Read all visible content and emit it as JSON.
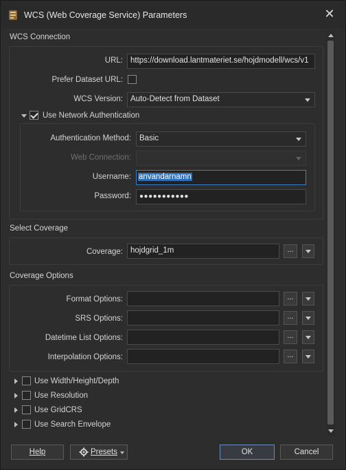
{
  "window": {
    "title": "WCS (Web Coverage Service) Parameters"
  },
  "wcs_connection": {
    "section_title": "WCS Connection",
    "url_label": "URL:",
    "url_value": "https://download.lantmateriet.se/hojdmodell/wcs/v1",
    "prefer_label": "Prefer Dataset URL:",
    "prefer_checked": false,
    "version_label": "WCS Version:",
    "version_value": "Auto-Detect from Dataset",
    "net_auth_label": "Use Network Authentication",
    "net_auth_checked": true,
    "auth_method_label": "Authentication Method:",
    "auth_method_value": "Basic",
    "web_conn_label": "Web Connection:",
    "web_conn_value": "",
    "username_label": "Username:",
    "username_value": "anvandarnamn",
    "password_label": "Password:",
    "password_value": "●●●●●●●●●●●"
  },
  "select_coverage": {
    "section_title": "Select Coverage",
    "coverage_label": "Coverage:",
    "coverage_value": "hojdgrid_1m"
  },
  "coverage_options": {
    "section_title": "Coverage Options",
    "format_label": "Format Options:",
    "srs_label": "SRS Options:",
    "datetime_label": "Datetime List Options:",
    "interp_label": "Interpolation Options:"
  },
  "extra_options": [
    {
      "label": "Use Width/Height/Depth"
    },
    {
      "label": "Use Resolution"
    },
    {
      "label": "Use GridCRS"
    },
    {
      "label": "Use Search Envelope"
    }
  ],
  "footer": {
    "help_label": "Help",
    "presets_label": "Presets",
    "ok_label": "OK",
    "cancel_label": "Cancel"
  },
  "ellipsis_glyph": "..."
}
